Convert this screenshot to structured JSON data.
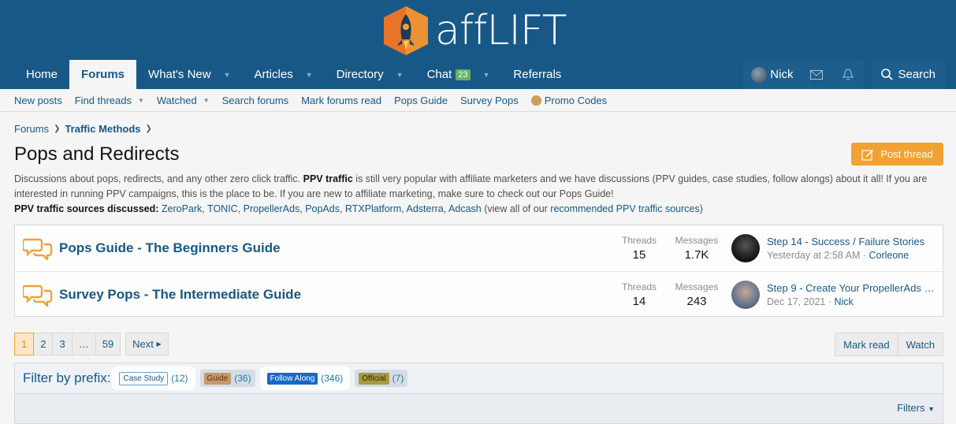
{
  "logo": {
    "text_aff": "aff",
    "text_lift": "LIFT"
  },
  "nav": {
    "items": [
      {
        "label": "Home",
        "caret": false
      },
      {
        "label": "Forums",
        "caret": false,
        "active": true
      },
      {
        "label": "What's New",
        "caret": true
      },
      {
        "label": "Articles",
        "caret": true
      },
      {
        "label": "Directory",
        "caret": true
      },
      {
        "label": "Chat",
        "caret": true,
        "badge": "23"
      },
      {
        "label": "Referrals",
        "caret": false
      }
    ],
    "user": "Nick",
    "search": "Search"
  },
  "subnav": {
    "items": [
      "New posts",
      "Find threads",
      "Watched",
      "Search forums",
      "Mark forums read",
      "Pops Guide",
      "Survey Pops",
      "Promo Codes"
    ]
  },
  "breadcrumb": {
    "root": "Forums",
    "current": "Traffic Methods"
  },
  "page": {
    "title": "Pops and Redirects",
    "post_button": "Post thread"
  },
  "description": {
    "p1_a": "Discussions about pops, redirects, and any other zero click traffic. ",
    "p1_b": "PPV traffic",
    "p1_c": " is still very popular with affiliate marketers and we have discussions (PPV guides, case studies, follow alongs) about it all! If you are interested in running PPV campaigns, this is the place to be. If you are new to affiliate marketing, make sure to check out our Pops Guide!",
    "p2_label": "PPV traffic sources discussed",
    "sources": [
      "ZeroPark",
      "TONIC",
      "PropellerAds",
      "PopAds",
      "RTXPlatform",
      "Adsterra",
      "Adcash"
    ],
    "p2_tail_a": "(view all of our ",
    "p2_link": "recommended PPV traffic sources",
    "p2_tail_b": ")"
  },
  "nodes": [
    {
      "title": "Pops Guide - The Beginners Guide",
      "threads_label": "Threads",
      "threads": "15",
      "messages_label": "Messages",
      "messages": "1.7K",
      "last_title": "Step 14 - Success / Failure Stories",
      "last_time": "Yesterday at 2:58 AM",
      "last_user": "Corleone"
    },
    {
      "title": "Survey Pops - The Intermediate Guide",
      "threads_label": "Threads",
      "threads": "14",
      "messages_label": "Messages",
      "messages": "243",
      "last_title": "Step 9 - Create Your PropellerAds …",
      "last_time": "Dec 17, 2021",
      "last_user": "Nick"
    }
  ],
  "pager": {
    "pages": [
      "1",
      "2",
      "3",
      "…",
      "59"
    ],
    "next": "Next"
  },
  "actions": {
    "mark_read": "Mark read",
    "watch": "Watch"
  },
  "filter": {
    "label": "Filter by prefix:",
    "prefixes": [
      {
        "name": "Case Study",
        "count": "(12)"
      },
      {
        "name": "Guide",
        "count": "(36)"
      },
      {
        "name": "Follow Along",
        "count": "(346)"
      },
      {
        "name": "Official",
        "count": "(7)"
      }
    ],
    "filters_button": "Filters"
  },
  "colors": {
    "header": "#185886",
    "accent": "#f1a232",
    "link": "#185886",
    "follow_along": "#1669c8"
  }
}
